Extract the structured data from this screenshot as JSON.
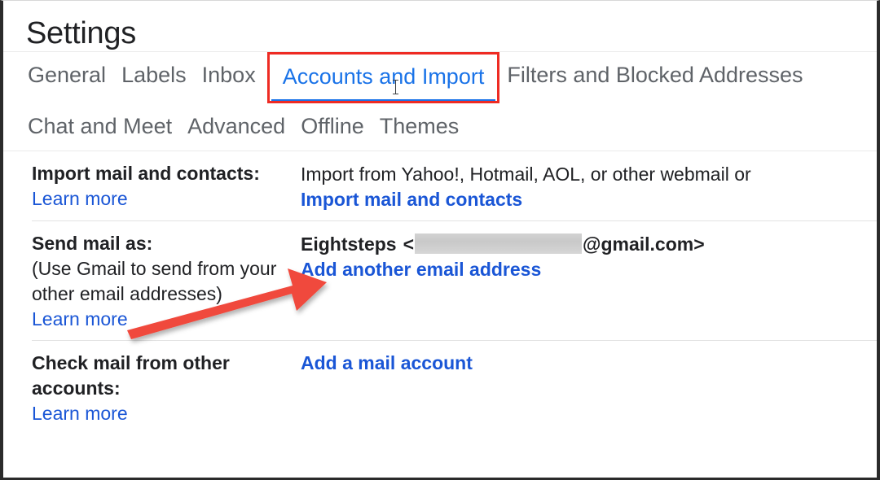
{
  "page": {
    "title": "Settings"
  },
  "tabs": {
    "row1": [
      {
        "label": "General",
        "active": false
      },
      {
        "label": "Labels",
        "active": false
      },
      {
        "label": "Inbox",
        "active": false
      },
      {
        "label": "Accounts and Import",
        "active": true
      },
      {
        "label": "Filters and Blocked Addresses",
        "active": false
      }
    ],
    "row2": [
      {
        "label": "Chat and Meet",
        "active": false
      },
      {
        "label": "Advanced",
        "active": false
      },
      {
        "label": "Offline",
        "active": false
      },
      {
        "label": "Themes",
        "active": false
      }
    ]
  },
  "sections": {
    "import": {
      "label": "Import mail and contacts:",
      "learn_more": "Learn more",
      "description": "Import from Yahoo!, Hotmail, AOL, or other webmail or",
      "action_link": "Import mail and contacts"
    },
    "send_mail_as": {
      "label": "Send mail as:",
      "note": "(Use Gmail to send from your other email addresses)",
      "learn_more": "Learn more",
      "address_name": "Eightsteps",
      "address_open_bracket": "<",
      "address_redacted": "",
      "address_domain": "@gmail.com>",
      "action_link": "Add another email address"
    },
    "check_mail": {
      "label": "Check mail from other accounts:",
      "learn_more": "Learn more",
      "action_link": "Add a mail account"
    }
  },
  "annotations": {
    "highlight_box": {
      "target": "Accounts and Import",
      "color": "#ee2b23",
      "shape": "rectangle"
    },
    "arrow": {
      "color": "#f0483c",
      "points_to": "Eightsteps <...@gmail.com>",
      "direction": "up-right"
    }
  },
  "colors": {
    "accent_blue": "#1a73e8",
    "link_blue": "#1a56d6",
    "text": "#202124",
    "muted_text": "#5f6368",
    "annotation_red": "#ee2b23",
    "arrow_red": "#f0483c",
    "divider": "#e3e3e3"
  }
}
